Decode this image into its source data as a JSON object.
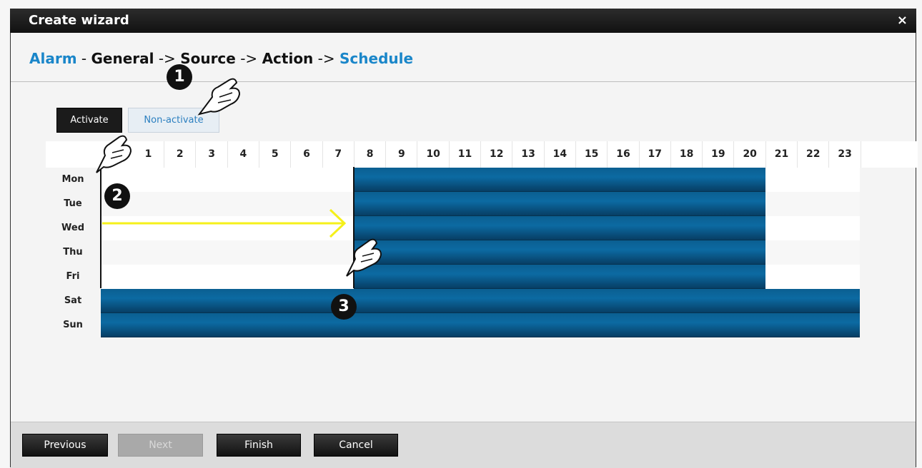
{
  "window": {
    "title": "Create wizard",
    "close_glyph": "×"
  },
  "breadcrumb": {
    "alarm": "Alarm",
    "dash": " - ",
    "general": "General",
    "arrow1": " -> ",
    "source": "Source",
    "arrow2": " -> ",
    "action": "Action",
    "arrow3": " -> ",
    "schedule": "Schedule"
  },
  "mode_buttons": {
    "activate": "Activate",
    "non_activate": "Non-activate"
  },
  "schedule": {
    "hours": [
      "1",
      "2",
      "3",
      "4",
      "5",
      "6",
      "7",
      "8",
      "9",
      "10",
      "11",
      "12",
      "13",
      "14",
      "15",
      "16",
      "17",
      "18",
      "19",
      "20",
      "21",
      "22",
      "23"
    ],
    "days": [
      "Mon",
      "Tue",
      "Wed",
      "Thu",
      "Fri",
      "Sat",
      "Sun"
    ]
  },
  "annotations": {
    "step1": "1",
    "step2": "2",
    "step3": "3"
  },
  "footer": {
    "previous": "Previous",
    "next": "Next",
    "finish": "Finish",
    "cancel": "Cancel"
  },
  "colors": {
    "active_block": "#0c6aa2",
    "link_blue": "#1a86c9",
    "annotation_arrow": "#f5f01a"
  }
}
